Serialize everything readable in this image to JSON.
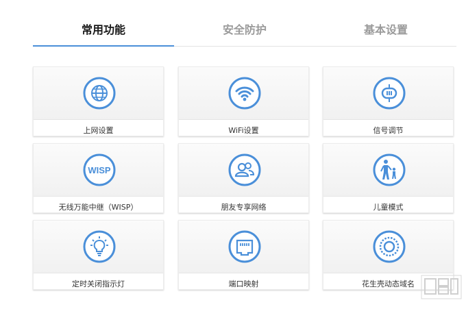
{
  "tabs": [
    {
      "label": "常用功能",
      "active": true
    },
    {
      "label": "安全防护",
      "active": false
    },
    {
      "label": "基本设置",
      "active": false
    }
  ],
  "accent_color": "#4a8fd9",
  "cards": [
    {
      "label": "上网设置",
      "icon": "globe-icon"
    },
    {
      "label": "WiFi设置",
      "icon": "wifi-icon"
    },
    {
      "label": "信号调节",
      "icon": "signal-adjust-icon"
    },
    {
      "label": "无线万能中继（WISP）",
      "icon": "wisp-icon"
    },
    {
      "label": "朋友专享网络",
      "icon": "friends-icon"
    },
    {
      "label": "儿童模式",
      "icon": "child-mode-icon"
    },
    {
      "label": "定时关闭指示灯",
      "icon": "light-bulb-icon"
    },
    {
      "label": "端口映射",
      "icon": "port-mapping-icon"
    },
    {
      "label": "花生壳动态域名",
      "icon": "dynamic-dns-icon"
    }
  ]
}
